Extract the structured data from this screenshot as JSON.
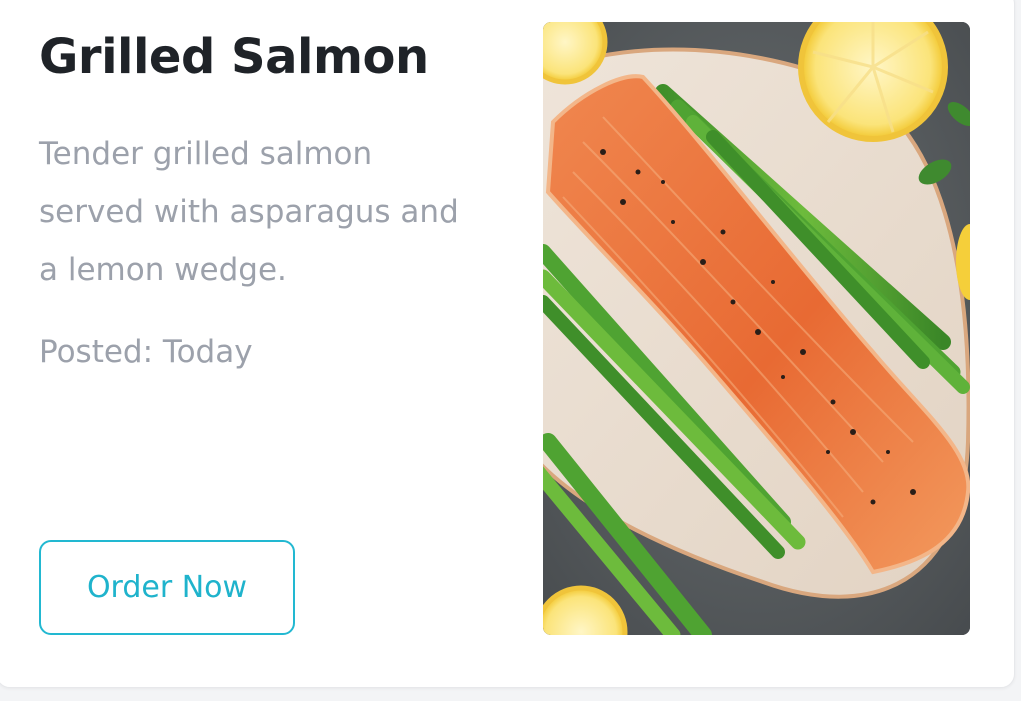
{
  "card": {
    "title": "Grilled Salmon",
    "description": "Tender grilled salmon served with asparagus and a lemon wedge.",
    "posted": "Posted: Today",
    "order_label": "Order Now"
  },
  "colors": {
    "accent": "#22b8d1",
    "title": "#1f2328",
    "muted": "#9ca1ab"
  }
}
